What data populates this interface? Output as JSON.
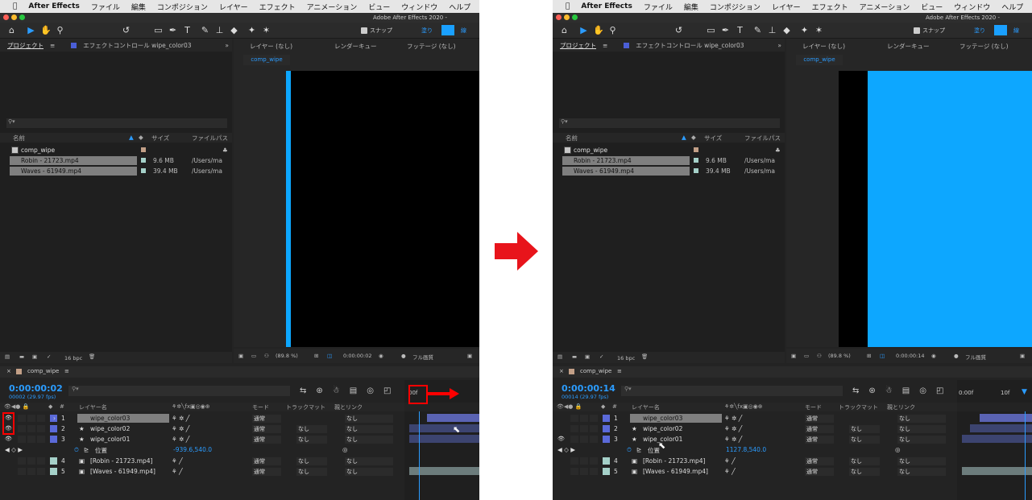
{
  "menu": {
    "apple": "",
    "app": "After Effects",
    "items": [
      "ファイル",
      "編集",
      "コンポジション",
      "レイヤー",
      "エフェクト",
      "アニメーション",
      "ビュー",
      "ウィンドウ",
      "ヘルプ"
    ]
  },
  "window_title": "Adobe After Effects 2020 -",
  "toolbar": {
    "snap_label": "スナップ",
    "fill_label": "塗り",
    "stroke_label": "線",
    "fill_color": "#1aa0ff"
  },
  "project": {
    "tab": "プロジェクト",
    "effects_tab": "エフェクトコントロール wipe_color03",
    "columns": {
      "name": "名前",
      "size": "サイズ",
      "path": "ファイルパス"
    },
    "items": [
      {
        "name": "comp_wipe",
        "size": "",
        "path": ""
      },
      {
        "name": "Robin - 21723.mp4",
        "size": "9.6 MB",
        "path": "/Users/ma"
      },
      {
        "name": "Waves - 61949.mp4",
        "size": "39.4 MB",
        "path": "/Users/ma"
      }
    ],
    "bpc": "16 bpc"
  },
  "viewer": {
    "tabs": [
      "レイヤー (なし)",
      "レンダーキュー",
      "フッテージ (なし)"
    ],
    "comp_tab": "comp_wipe",
    "zoom": "(89.8 %)",
    "quality": "フル画質"
  },
  "timeline": {
    "comp_name": "comp_wipe",
    "columns": {
      "layer_name": "レイヤー名",
      "mode": "モード",
      "track": "トラックマット",
      "parent": "親とリンク"
    },
    "layers": [
      {
        "num": "1",
        "name": "wipe_color03",
        "mode": "通常",
        "track": "",
        "parent": "なし",
        "color": "#5b6ad9"
      },
      {
        "num": "2",
        "name": "wipe_color02",
        "mode": "通常",
        "track": "なし",
        "parent": "なし",
        "color": "#5b6ad9"
      },
      {
        "num": "3",
        "name": "wipe_color01",
        "mode": "通常",
        "track": "なし",
        "parent": "なし",
        "color": "#5b6ad9"
      },
      {
        "num": "4",
        "name": "[Robin - 21723.mp4]",
        "mode": "通常",
        "track": "なし",
        "parent": "なし",
        "color": "#a5d1c9"
      },
      {
        "num": "5",
        "name": "[Waves - 61949.mp4]",
        "mode": "通常",
        "track": "なし",
        "parent": "なし",
        "color": "#a5d1c9"
      }
    ],
    "property_label": "位置"
  },
  "before": {
    "timecode": "0:00:00:02",
    "frame_info": "00002 (29.97 fps)",
    "viewer_time": "0:00:00:02",
    "position_value": "-939.6,540.0",
    "ruler_label": "00f",
    "blue_fill_fraction": 0.02
  },
  "after": {
    "timecode": "0:00:00:14",
    "frame_info": "00014 (29.97 fps)",
    "viewer_time": "0:00:00:14",
    "position_value": "1127.8,540.0",
    "ruler_labels": [
      "0:00f",
      "10f"
    ],
    "blue_fill_fraction": 0.85
  },
  "arrow_color": "#e8141b"
}
